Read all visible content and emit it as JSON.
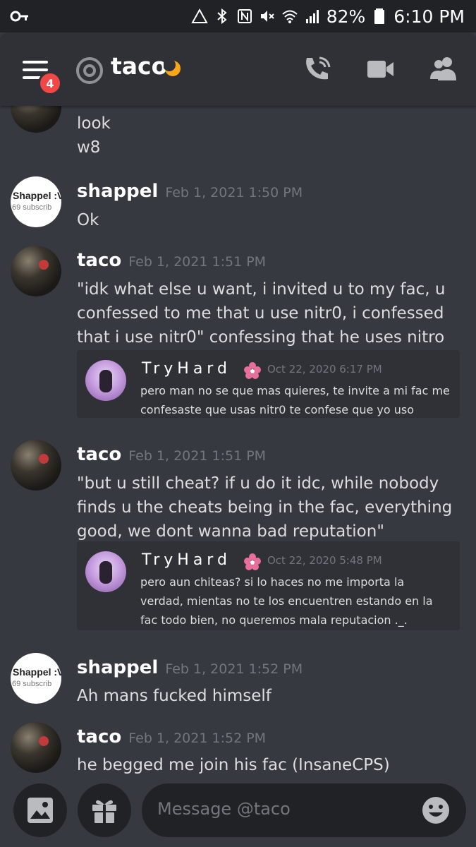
{
  "status_bar": {
    "battery": "82%",
    "time": "6:10 PM",
    "icons": [
      "key-icon",
      "data-saver-icon",
      "bluetooth-icon",
      "nfc-icon",
      "mute-icon",
      "wifi-icon",
      "signal-icon",
      "battery-icon"
    ]
  },
  "header": {
    "badge_count": "4",
    "title": "taco",
    "icons": [
      "menu-icon",
      "at-icon",
      "moon-icon",
      "call-icon",
      "video-icon",
      "members-icon"
    ]
  },
  "messages": {
    "m0": {
      "lines": [
        "look",
        "w8"
      ]
    },
    "m1": {
      "author": "shappel",
      "timestamp": "Feb 1, 2021 1:50 PM",
      "text": "Ok",
      "avatar_line1": "Shappel :V",
      "avatar_line2": "69 subscrib"
    },
    "m2": {
      "author": "taco",
      "timestamp": "Feb 1, 2021 1:51 PM",
      "text": "\"idk what else u want, i invited u to my fac, u confessed to me that u use nitr0, i confessed that i use nitr0\" confessing that he uses nitro",
      "embed": {
        "author": "TryHard",
        "timestamp": "Oct 22, 2020 6:17 PM",
        "text": "pero man no se que mas quieres, te invite a mi fac me confesaste que usas nitr0 te confese que yo uso"
      }
    },
    "m3": {
      "author": "taco",
      "timestamp": "Feb 1, 2021 1:51 PM",
      "text": "\"but u still cheat? if u do it idc, while nobody finds u the cheats being in the fac, everything good, we dont wanna bad reputation\"",
      "embed": {
        "author": "TryHard",
        "timestamp": "Oct 22, 2020 5:48 PM",
        "text": "pero aun chiteas? si lo haces no me importa la verdad, mientas no te los encuentren estando en la fac todo bien, no queremos mala reputacion ._."
      }
    },
    "m4": {
      "author": "shappel",
      "timestamp": "Feb 1, 2021 1:52 PM",
      "text": "Ah mans fucked himself",
      "avatar_line1": "Shappel :V",
      "avatar_line2": "69 subscrib"
    },
    "m5": {
      "author": "taco",
      "timestamp": "Feb 1, 2021 1:52 PM",
      "text": "he begged me join his fac (InsaneCPS)"
    }
  },
  "composer": {
    "placeholder": "Message @taco",
    "icons": [
      "image-icon",
      "gift-icon",
      "emoji-icon"
    ]
  },
  "colors": {
    "background": "#36393f",
    "header": "#2f3136",
    "statusbar": "#202225",
    "badge": "#f04747",
    "moon": "#faa61a",
    "timestamp": "#72767d"
  }
}
